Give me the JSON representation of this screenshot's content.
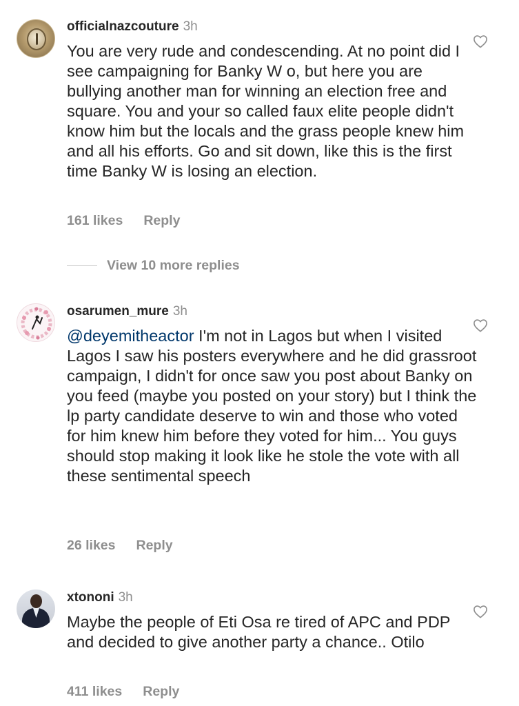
{
  "comments": [
    {
      "username": "officialnazcouture",
      "time": "3h",
      "text": "You are very rude and condescending. At no point did I see campaigning for Banky W o, but here you are bullying another man for winning an election free and square. You and your so called faux elite people didn't know him but the locals and the grass people knew him and all his efforts. Go and sit down, like this is the first time Banky W is losing an election.",
      "likes": "161 likes",
      "reply": "Reply",
      "view_more": "View 10 more replies"
    },
    {
      "username": "osarumen_mure",
      "time": "3h",
      "mention": "@deyemitheactor",
      "text": " I'm not in Lagos but when I visited Lagos I saw his posters everywhere and he did grassroot campaign, I didn't for once saw you post about Banky on you feed (maybe you posted on your story) but I think the lp party candidate deserve to win and those who voted for him knew him before they voted for him... You guys should stop making it look like he stole the vote with all these sentimental speech",
      "likes": "26 likes",
      "reply": "Reply"
    },
    {
      "username": "xtononi",
      "time": "3h",
      "text": "Maybe the people of Eti Osa re tired of APC and PDP and decided to give another party a chance.. Otilo",
      "likes": "411 likes",
      "reply": "Reply"
    }
  ],
  "icons": {
    "like": "heart-outline-icon"
  }
}
